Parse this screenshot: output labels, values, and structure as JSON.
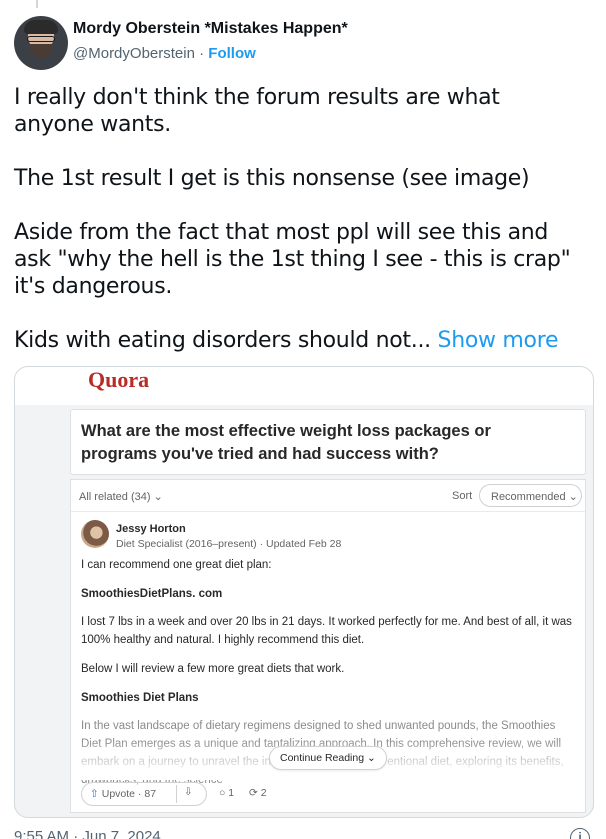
{
  "author": {
    "name": "Mordy Oberstein *Mistakes Happen*",
    "handle": "@MordyOberstein",
    "separator": " · ",
    "follow_label": "Follow"
  },
  "tweet": {
    "paragraphs": [
      "I really don't think the forum results are what anyone wants.",
      "The 1st result I get is this nonsense (see image)",
      "Aside from the fact that most ppl will see this and ask \"why the hell is the 1st thing I see - this is crap\" it's dangerous.",
      "Kids with eating disorders should not..."
    ],
    "show_more_label": "Show more",
    "timestamp": "9:55 AM · Jun 7, 2024"
  },
  "embedded_image": {
    "logo": "Quora",
    "question": "What are the most effective weight loss packages or programs you've tried and had success with?",
    "related_label": "All related (34)",
    "sort_label": "Sort",
    "sort_value": "Recommended",
    "answer": {
      "author": "Jessy Horton",
      "credential": "Diet Specialist (2016–present) · Updated Feb 28",
      "lines": [
        "I can recommend one great diet plan:",
        "SmoothiesDietPlans. com",
        "I lost 7 lbs in a week and over 20 lbs in 21 days. It worked perfectly for me. And best of all, it was 100% healthy and natural. I highly recommend this diet.",
        "Below I will review a few more great diets that work.",
        "Smoothies Diet Plans",
        "In the vast landscape of dietary regimens designed to shed unwanted pounds, the Smoothies Diet Plan emerges as a unique and tantalizing approach. In this comprehensive review, we will embark on a journey to unravel the intricacies of this unconventional diet, exploring its benefits, drawbacks, and the science"
      ],
      "continue_label": "Continue Reading",
      "upvote_label": "Upvote",
      "upvote_count": "87",
      "comment_count": "1",
      "share_count": "2"
    }
  },
  "icons": {
    "info": "info-icon",
    "upvote": "arrow-up-icon",
    "downvote": "arrow-down-icon",
    "comment": "comment-icon",
    "share": "share-icon"
  },
  "colors": {
    "link": "#1d9bf0",
    "quora_brand": "#b92b27"
  }
}
